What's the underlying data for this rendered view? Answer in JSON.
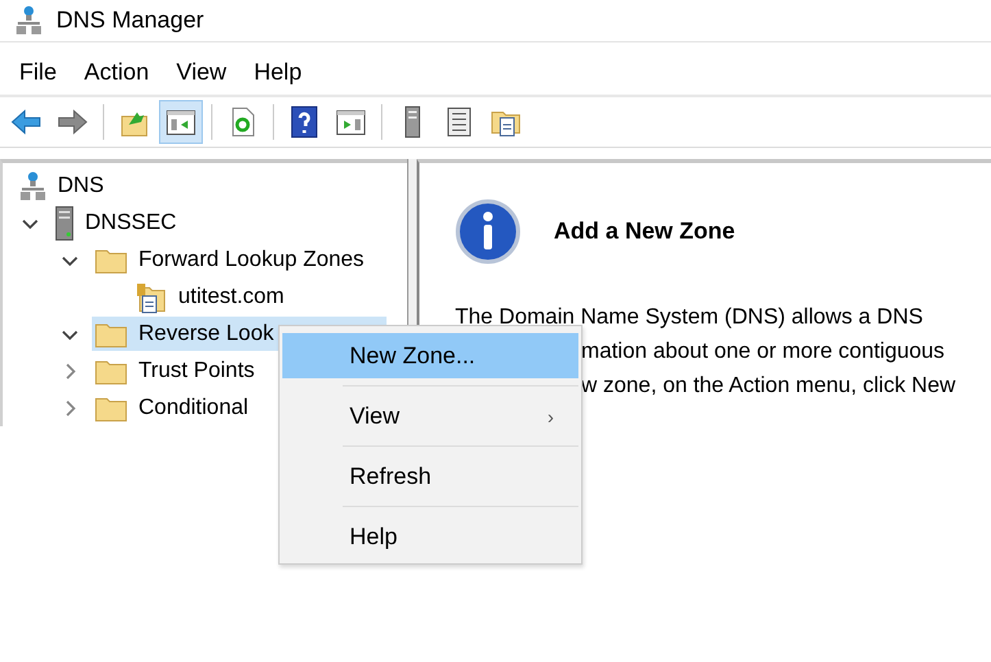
{
  "window": {
    "title": "DNS Manager"
  },
  "menu_bar": [
    {
      "label": "File"
    },
    {
      "label": "Action"
    },
    {
      "label": "View"
    },
    {
      "label": "Help"
    }
  ],
  "toolbar": [
    {
      "kind": "back",
      "pressed": false
    },
    {
      "kind": "forward",
      "pressed": false
    },
    {
      "kind": "up",
      "pressed": false
    },
    {
      "kind": "tree-toggle",
      "pressed": true
    },
    {
      "kind": "refresh",
      "pressed": false
    },
    {
      "kind": "help",
      "pressed": false
    },
    {
      "kind": "action-pane",
      "pressed": false
    },
    {
      "kind": "server",
      "pressed": false
    },
    {
      "kind": "list",
      "pressed": false
    },
    {
      "kind": "folder-doc",
      "pressed": false
    }
  ],
  "tree": [
    {
      "label": "DNS",
      "kind": "dns",
      "selected": false,
      "children": [
        {
          "label": "DNSSEC",
          "kind": "server",
          "selected": false,
          "expanded": true,
          "children": [
            {
              "label": "Forward Lookup Zones",
              "kind": "folder",
              "selected": false,
              "expanded": true,
              "children": [
                {
                  "label": "utitest.com",
                  "kind": "zone",
                  "selected": false
                }
              ]
            },
            {
              "label": "Reverse Look",
              "kind": "folder",
              "selected": true,
              "expanded": true
            },
            {
              "label": "Trust Points",
              "kind": "folder",
              "selected": false,
              "expanded": false
            },
            {
              "label": "Conditional",
              "kind": "folder",
              "selected": false,
              "expanded": false
            }
          ]
        }
      ]
    }
  ],
  "detail": {
    "heading": "Add a New Zone",
    "lines": [
      {
        "text": "The Domain Name System (DNS) allows a DNS",
        "cut_by_menu": false
      },
      {
        "text": "mation about one or more contiguous",
        "cut_by_menu": true
      },
      {
        "text": "w zone, on the Action menu, click New",
        "cut_by_menu": true
      }
    ]
  },
  "context_menu": [
    {
      "label": "New Zone...",
      "selected": true
    },
    {
      "label": "View",
      "selected": false,
      "submenu_arrow": "›"
    },
    {
      "label": "Refresh",
      "selected": false
    },
    {
      "label": "Help",
      "selected": false
    }
  ]
}
